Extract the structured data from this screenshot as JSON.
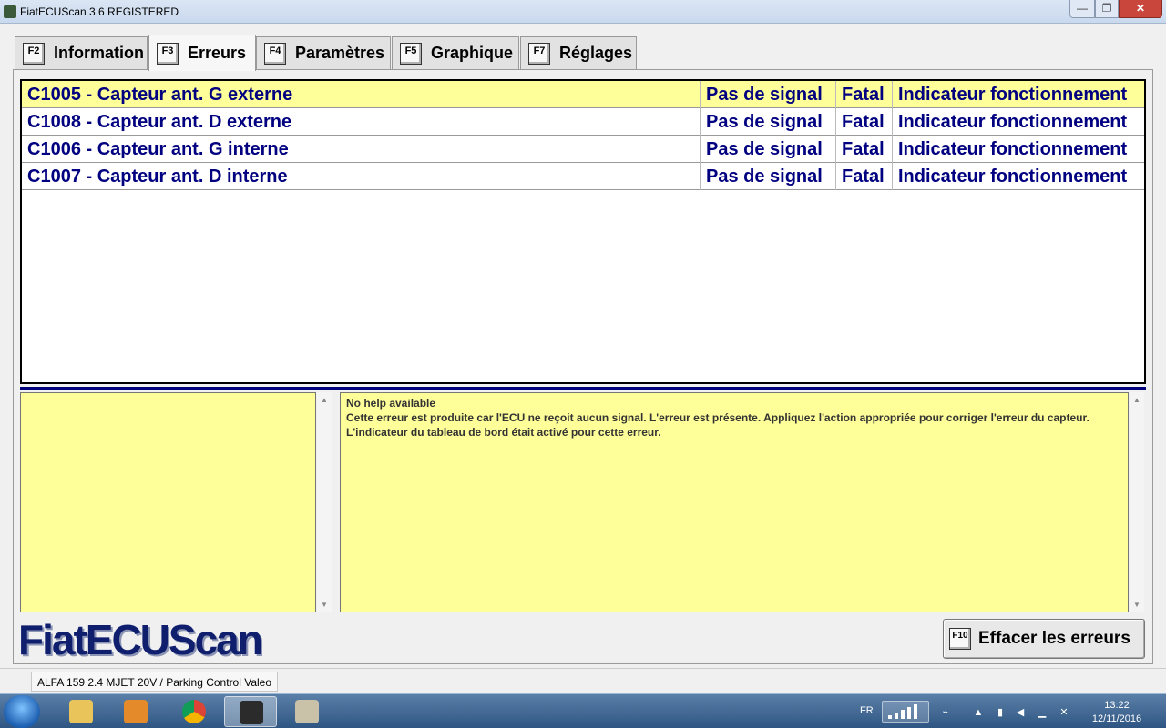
{
  "window": {
    "title": "FiatECUScan 3.6 REGISTERED",
    "minimize_glyph": "—",
    "maximize_glyph": "❐",
    "close_glyph": "✕"
  },
  "tabs": [
    {
      "key": "F2",
      "label": "Information"
    },
    {
      "key": "F3",
      "label": "Erreurs"
    },
    {
      "key": "F4",
      "label": "Paramètres"
    },
    {
      "key": "F5",
      "label": "Graphique"
    },
    {
      "key": "F7",
      "label": "Réglages"
    }
  ],
  "active_tab": "Erreurs",
  "errors": [
    {
      "code": "C1005 - Capteur ant. G externe",
      "signal": "Pas de signal",
      "severity": "Fatal",
      "indicator": "Indicateur fonctionnement"
    },
    {
      "code": "C1008 - Capteur ant. D externe",
      "signal": "Pas de signal",
      "severity": "Fatal",
      "indicator": "Indicateur fonctionnement"
    },
    {
      "code": "C1006 - Capteur ant. G interne",
      "signal": "Pas de signal",
      "severity": "Fatal",
      "indicator": "Indicateur fonctionnement"
    },
    {
      "code": "C1007 - Capteur ant. D interne",
      "signal": "Pas de signal",
      "severity": "Fatal",
      "indicator": "Indicateur fonctionnement"
    }
  ],
  "help": {
    "title": "No help available",
    "text": "Cette erreur est produite car l'ECU ne reçoit aucun signal. L'erreur est présente. Appliquez l'action appropriée pour corriger l'erreur du capteur. L'indicateur du tableau de bord était activé pour cette erreur."
  },
  "logo": "FiatECUScan",
  "clear_button": {
    "key": "F10",
    "label": "Effacer les erreurs"
  },
  "status": {
    "vehicle": "ALFA 159 2.4 MJET 20V / Parking Control Valeo"
  },
  "taskbar": {
    "language": "FR",
    "time": "13:22",
    "date": "12/11/2016"
  },
  "colors": {
    "selected_row": "#ffff99",
    "error_text": "#000080",
    "help_bg": "#ffff99",
    "divider": "#00007a"
  }
}
